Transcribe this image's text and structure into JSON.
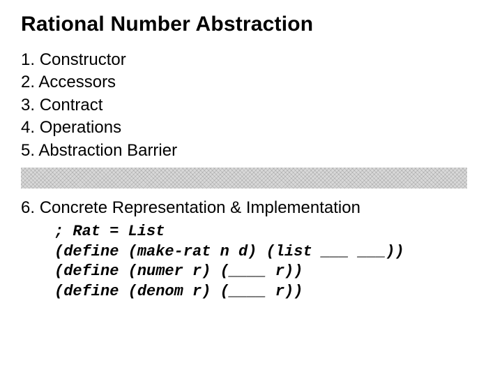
{
  "title": "Rational Number Abstraction",
  "items": {
    "i1": {
      "num": "1.",
      "text": "Constructor"
    },
    "i2": {
      "num": "2.",
      "text": "Accessors"
    },
    "i3": {
      "num": "3.",
      "text": "Contract"
    },
    "i4": {
      "num": "4.",
      "text": "Operations"
    },
    "i5": {
      "num": "5.",
      "text": "Abstraction Barrier"
    },
    "i6": {
      "num": "6.",
      "text": "Concrete Representation & Implementation"
    }
  },
  "code": {
    "l1": "; Rat = List",
    "l2": "(define (make-rat n d) (list ___ ___))",
    "l3": "(define (numer r) (____ r))",
    "l4": "(define (denom r) (____ r))"
  }
}
